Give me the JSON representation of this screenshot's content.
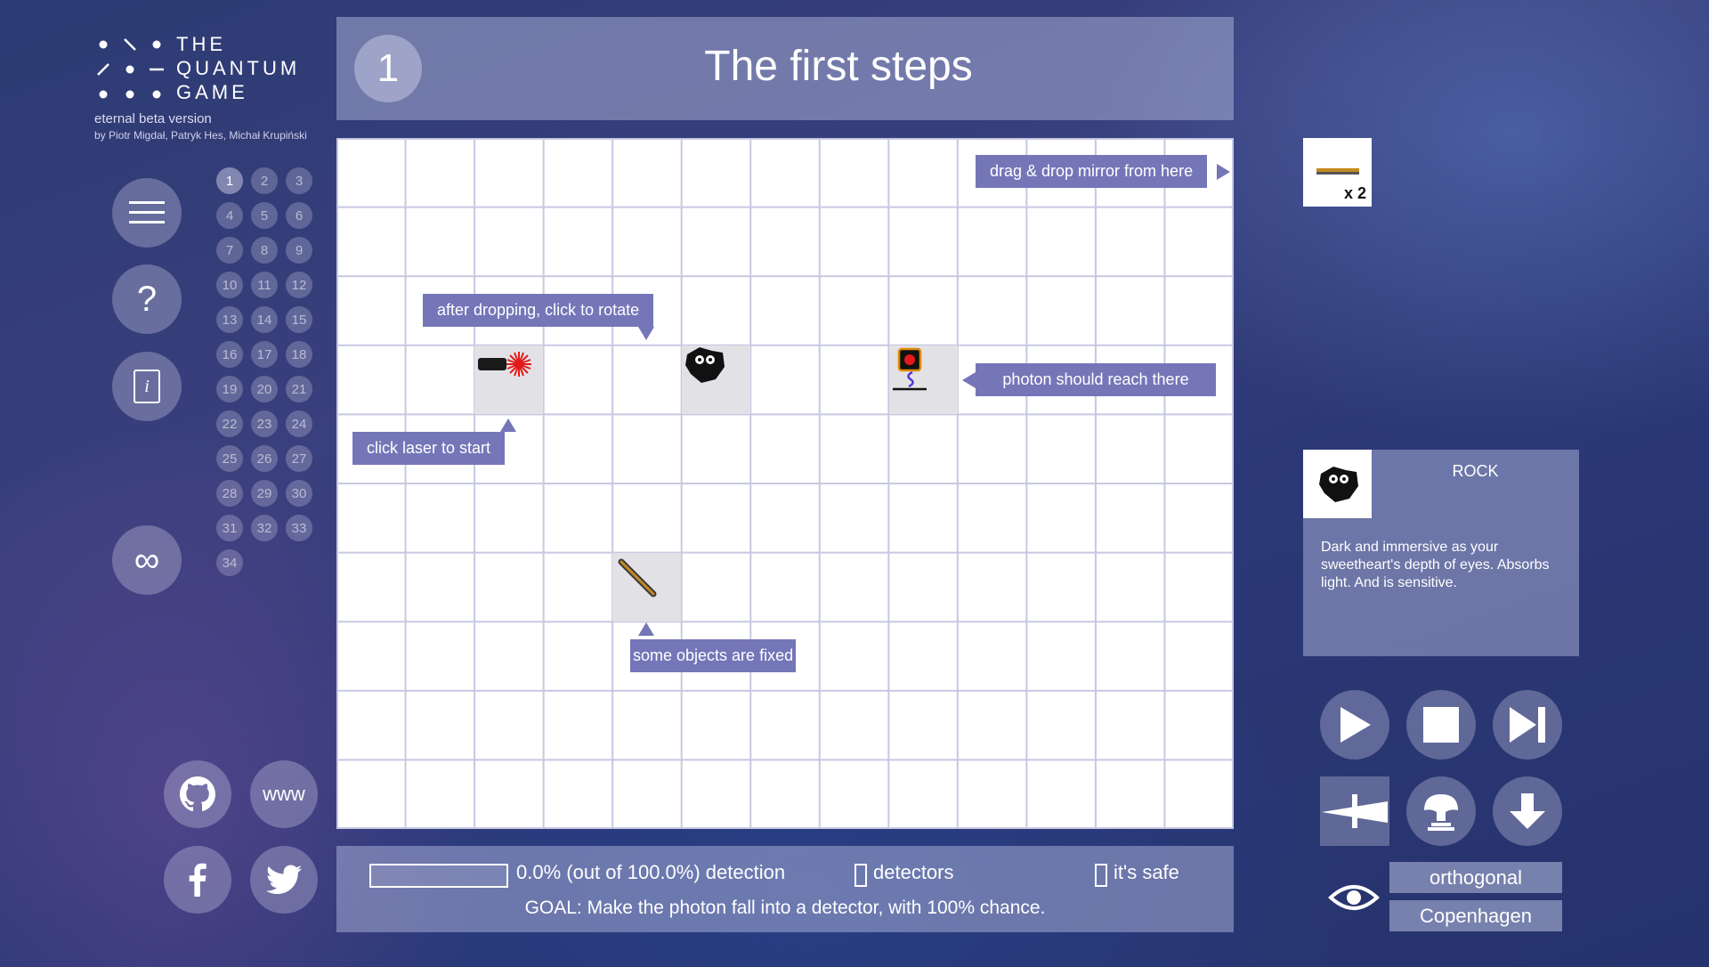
{
  "logo": {
    "line1": "THE",
    "line2": "QUANTUM",
    "line3": "GAME",
    "beta": "eternal beta version",
    "authors": "by Piotr Migdał, Patryk Hes, Michał Krupiński"
  },
  "nav": {
    "menu_icon": "hamburger-icon",
    "help_label": "?",
    "info_label": "i",
    "sandbox_label": "∞"
  },
  "levels": [
    "1",
    "2",
    "3",
    "4",
    "5",
    "6",
    "7",
    "8",
    "9",
    "10",
    "11",
    "12",
    "13",
    "14",
    "15",
    "16",
    "17",
    "18",
    "19",
    "20",
    "21",
    "22",
    "23",
    "24",
    "25",
    "26",
    "27",
    "28",
    "29",
    "30",
    "31",
    "32",
    "33",
    "34"
  ],
  "current_level": "1",
  "social": {
    "github_icon": "github-icon",
    "www_label": "www",
    "facebook_icon": "facebook-icon",
    "twitter_icon": "twitter-icon"
  },
  "header": {
    "level_number": "1",
    "title": "The first steps"
  },
  "board": {
    "cols": 13,
    "rows": 10,
    "tips": {
      "drag": "drag & drop mirror from here",
      "rotate": "after dropping, click to rotate",
      "laser": "click laser to start",
      "detector": "photon should reach there",
      "fixed": "some objects are fixed"
    }
  },
  "status": {
    "progress_fraction": 0.0,
    "detection_text": "0.0% (out of 100.0%) detection",
    "detectors_label": "detectors",
    "safe_label": "it's safe",
    "goal": "GOAL: Make the photon fall into a detector, with 100% chance."
  },
  "inventory": {
    "item": "mirror",
    "count_label": "x 2"
  },
  "info": {
    "title": "ROCK",
    "description": "Dark and immersive as your sweetheart's depth of eyes. Absorbs light. And is sensitive."
  },
  "controls": {
    "play_icon": "play-icon",
    "stop_icon": "stop-icon",
    "forward_icon": "step-forward-icon",
    "shoot_icon": "laser-icon",
    "mushroom_icon": "explosion-icon",
    "down_icon": "download-icon",
    "eye_icon": "eye-icon",
    "mode1": "orthogonal",
    "mode2": "Copenhagen"
  },
  "colors": {
    "tip": "#7476b8",
    "grid": "#c7c8e2",
    "accent_gold": "#c48a1f"
  }
}
